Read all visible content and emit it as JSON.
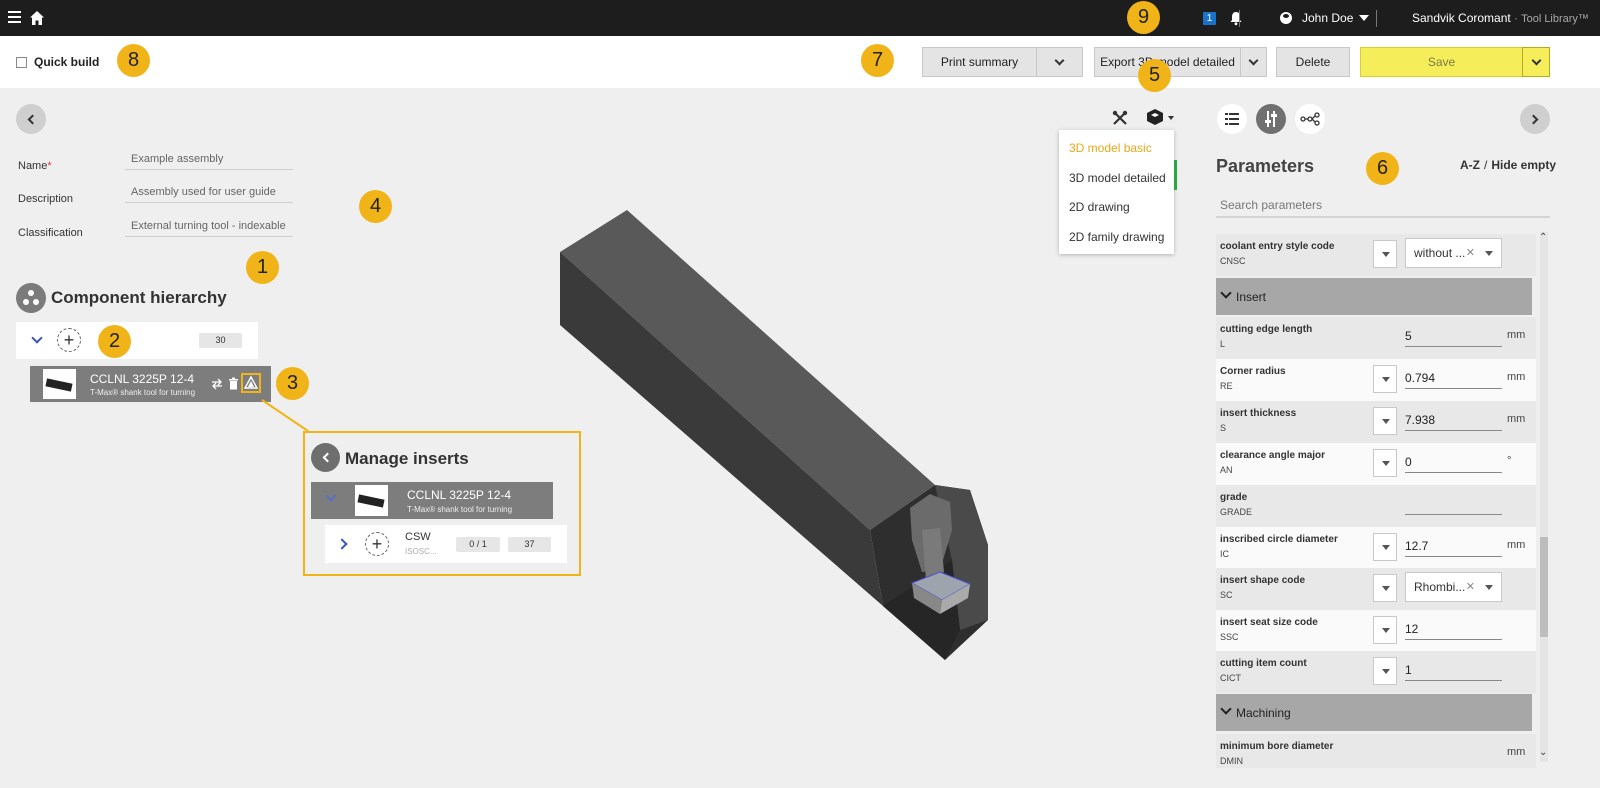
{
  "topbar": {
    "notif_count": "1",
    "user_name": "John Doe",
    "brand": "Sandvik Coromant",
    "brand_sep": "·",
    "brand_product": "Tool Library™"
  },
  "actions": {
    "quick_build": "Quick build",
    "print_summary": "Print summary",
    "export": "Export 3D model detailed",
    "delete": "Delete",
    "save": "Save"
  },
  "callouts": [
    "1",
    "2",
    "3",
    "4",
    "5",
    "6",
    "7",
    "8",
    "9"
  ],
  "form": {
    "name_label": "Name",
    "name_value": "Example assembly",
    "description_label": "Description",
    "description_value": "Assembly used for user guide",
    "classification_label": "Classification",
    "classification_value": "External turning tool - indexable"
  },
  "hierarchy": {
    "title": "Component hierarchy",
    "root_count": "30",
    "tool": {
      "name": "CCLNL 3225P 12-4",
      "sub": "T-Max® shank tool for turning"
    }
  },
  "manage_inserts": {
    "title": "Manage inserts",
    "tool": {
      "name": "CCLNL 3225P 12-4",
      "sub": "T-Max® shank tool for turning"
    },
    "insert": {
      "name": "CSW",
      "sub": "ISOSC...",
      "ratio": "0 / 1",
      "count": "37"
    }
  },
  "model_menu": {
    "items": [
      "3D model basic",
      "3D model detailed",
      "2D drawing",
      "2D family drawing"
    ],
    "active": "3D model basic"
  },
  "parameters": {
    "title": "Parameters",
    "sort": "A-Z",
    "hide_empty": "Hide empty",
    "search_placeholder": "Search parameters",
    "rows": [
      {
        "name": "coolant entry style code",
        "code": "CNSC",
        "value": "without ...",
        "kind": "select",
        "unit": ""
      },
      {
        "name": "cutting edge length",
        "code": "L",
        "value": "5",
        "kind": "input",
        "unit": "mm"
      },
      {
        "name": "Corner radius",
        "code": "RE",
        "value": "0.794",
        "kind": "input",
        "unit": "mm"
      },
      {
        "name": "insert thickness",
        "code": "S",
        "value": "7.938",
        "kind": "input",
        "unit": "mm"
      },
      {
        "name": "clearance angle major",
        "code": "AN",
        "value": "0",
        "kind": "input",
        "unit": "°"
      },
      {
        "name": "grade",
        "code": "GRADE",
        "value": "",
        "kind": "input",
        "unit": ""
      },
      {
        "name": "inscribed circle diameter",
        "code": "IC",
        "value": "12.7",
        "kind": "input",
        "unit": "mm"
      },
      {
        "name": "insert shape code",
        "code": "SC",
        "value": "Rhombi...",
        "kind": "select",
        "unit": ""
      },
      {
        "name": "insert seat size code",
        "code": "SSC",
        "value": "12",
        "kind": "input",
        "unit": ""
      },
      {
        "name": "cutting item count",
        "code": "CICT",
        "value": "1",
        "kind": "input",
        "unit": ""
      },
      {
        "name": "minimum bore diameter",
        "code": "DMIN",
        "value": "",
        "kind": "input",
        "unit": "mm"
      }
    ],
    "sections": [
      "Insert",
      "Machining"
    ]
  },
  "colors": {
    "accent": "#f1b418",
    "save": "#f5ee5a",
    "topbar": "#1d1d1d"
  }
}
